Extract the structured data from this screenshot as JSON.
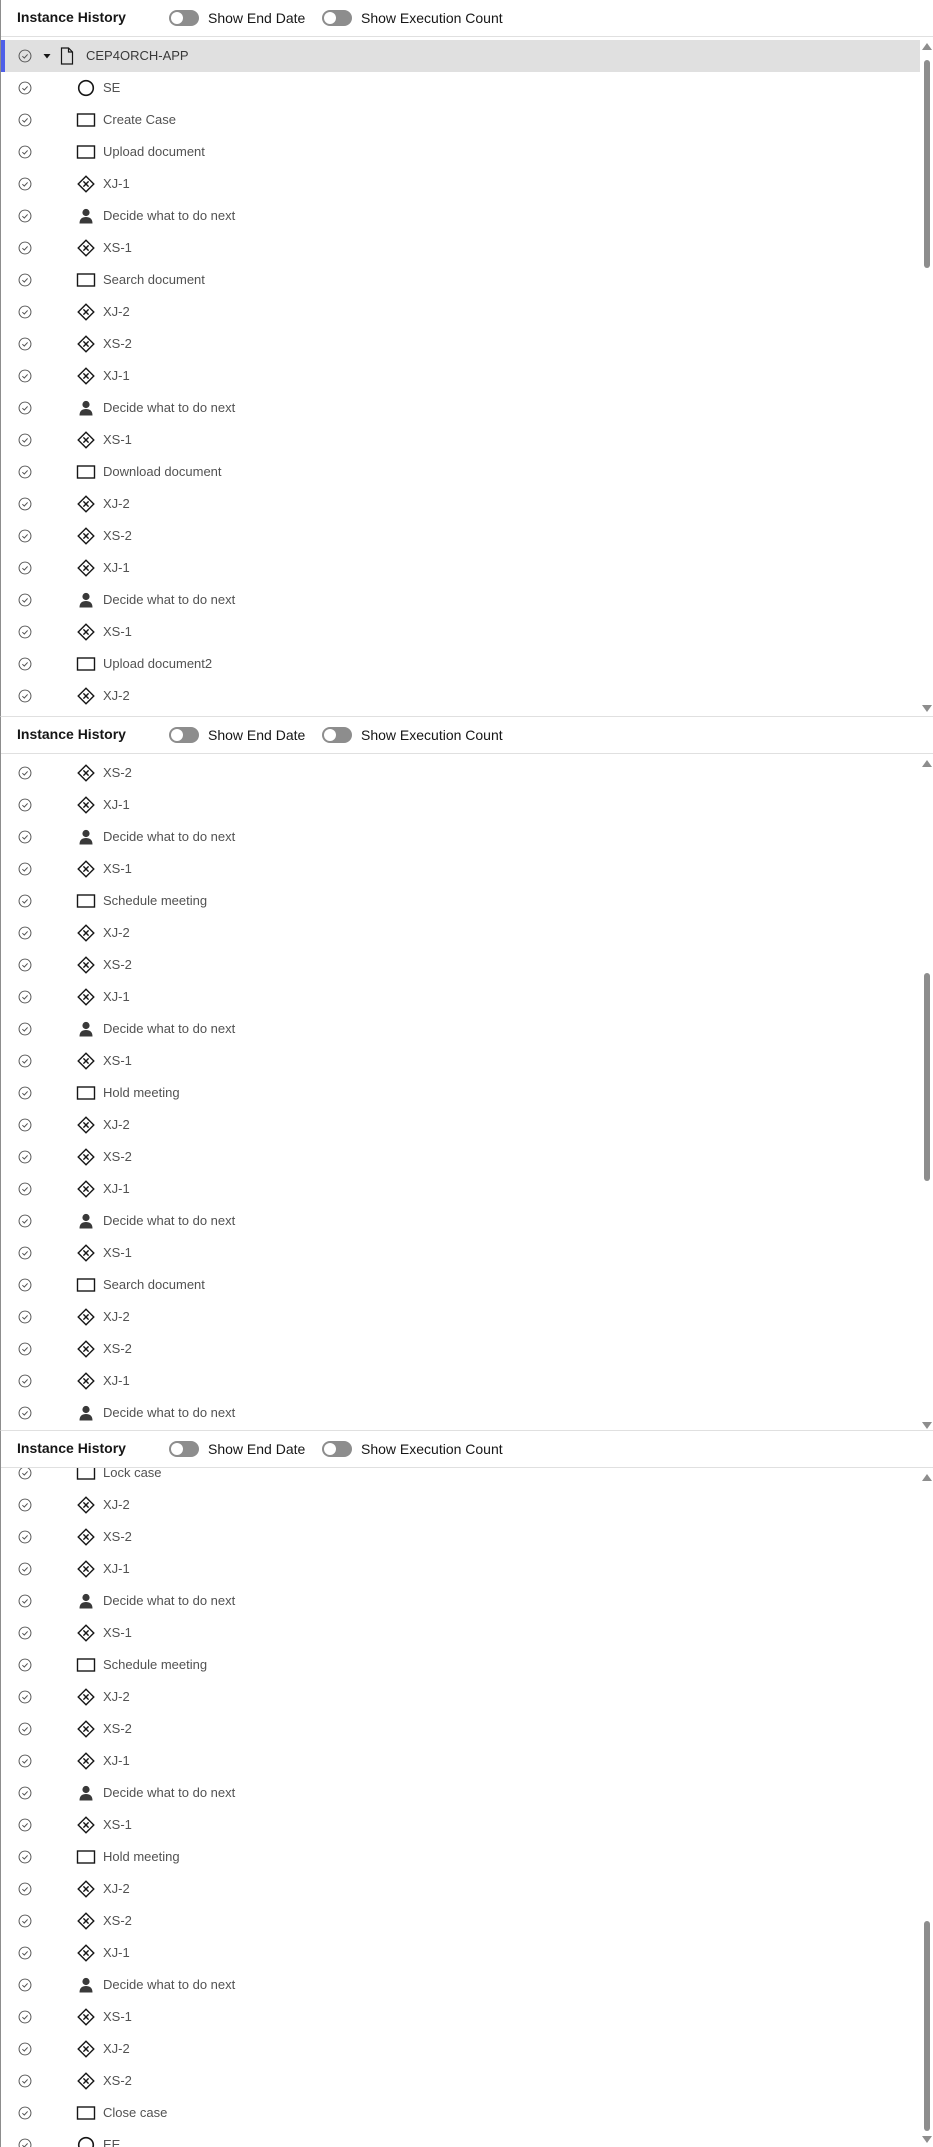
{
  "header": {
    "title": "Instance History",
    "toggle_end_date": "Show End Date",
    "toggle_exec_count": "Show Execution Count"
  },
  "root": {
    "label": "CEP4ORCH-APP"
  },
  "panel1": {
    "rows": [
      {
        "type": "event",
        "label": "SE"
      },
      {
        "type": "task",
        "label": "Create Case"
      },
      {
        "type": "task",
        "label": "Upload document"
      },
      {
        "type": "gateway",
        "label": "XJ-1"
      },
      {
        "type": "user",
        "label": "Decide what to do next"
      },
      {
        "type": "gateway",
        "label": "XS-1"
      },
      {
        "type": "task",
        "label": "Search document"
      },
      {
        "type": "gateway",
        "label": "XJ-2"
      },
      {
        "type": "gateway",
        "label": "XS-2"
      },
      {
        "type": "gateway",
        "label": "XJ-1"
      },
      {
        "type": "user",
        "label": "Decide what to do next"
      },
      {
        "type": "gateway",
        "label": "XS-1"
      },
      {
        "type": "task",
        "label": "Download document"
      },
      {
        "type": "gateway",
        "label": "XJ-2"
      },
      {
        "type": "gateway",
        "label": "XS-2"
      },
      {
        "type": "gateway",
        "label": "XJ-1"
      },
      {
        "type": "user",
        "label": "Decide what to do next"
      },
      {
        "type": "gateway",
        "label": "XS-1"
      },
      {
        "type": "task",
        "label": "Upload document2"
      },
      {
        "type": "gateway",
        "label": "XJ-2"
      }
    ]
  },
  "panel2": {
    "rows": [
      {
        "type": "gateway",
        "label": "XS-2"
      },
      {
        "type": "gateway",
        "label": "XJ-1"
      },
      {
        "type": "user",
        "label": "Decide what to do next"
      },
      {
        "type": "gateway",
        "label": "XS-1"
      },
      {
        "type": "task",
        "label": "Schedule meeting"
      },
      {
        "type": "gateway",
        "label": "XJ-2"
      },
      {
        "type": "gateway",
        "label": "XS-2"
      },
      {
        "type": "gateway",
        "label": "XJ-1"
      },
      {
        "type": "user",
        "label": "Decide what to do next"
      },
      {
        "type": "gateway",
        "label": "XS-1"
      },
      {
        "type": "task",
        "label": "Hold meeting"
      },
      {
        "type": "gateway",
        "label": "XJ-2"
      },
      {
        "type": "gateway",
        "label": "XS-2"
      },
      {
        "type": "gateway",
        "label": "XJ-1"
      },
      {
        "type": "user",
        "label": "Decide what to do next"
      },
      {
        "type": "gateway",
        "label": "XS-1"
      },
      {
        "type": "task",
        "label": "Search document"
      },
      {
        "type": "gateway",
        "label": "XJ-2"
      },
      {
        "type": "gateway",
        "label": "XS-2"
      },
      {
        "type": "gateway",
        "label": "XJ-1"
      },
      {
        "type": "user",
        "label": "Decide what to do next"
      }
    ]
  },
  "panel3": {
    "rows": [
      {
        "type": "task",
        "label": "Lock case"
      },
      {
        "type": "gateway",
        "label": "XJ-2"
      },
      {
        "type": "gateway",
        "label": "XS-2"
      },
      {
        "type": "gateway",
        "label": "XJ-1"
      },
      {
        "type": "user",
        "label": "Decide what to do next"
      },
      {
        "type": "gateway",
        "label": "XS-1"
      },
      {
        "type": "task",
        "label": "Schedule meeting"
      },
      {
        "type": "gateway",
        "label": "XJ-2"
      },
      {
        "type": "gateway",
        "label": "XS-2"
      },
      {
        "type": "gateway",
        "label": "XJ-1"
      },
      {
        "type": "user",
        "label": "Decide what to do next"
      },
      {
        "type": "gateway",
        "label": "XS-1"
      },
      {
        "type": "task",
        "label": "Hold meeting"
      },
      {
        "type": "gateway",
        "label": "XJ-2"
      },
      {
        "type": "gateway",
        "label": "XS-2"
      },
      {
        "type": "gateway",
        "label": "XJ-1"
      },
      {
        "type": "user",
        "label": "Decide what to do next"
      },
      {
        "type": "gateway",
        "label": "XS-1"
      },
      {
        "type": "gateway",
        "label": "XJ-2"
      },
      {
        "type": "gateway",
        "label": "XS-2"
      },
      {
        "type": "task",
        "label": "Close case"
      },
      {
        "type": "event",
        "label": "EE"
      }
    ]
  },
  "icons": {
    "check": "check-circle-icon",
    "event": "event-circle-icon",
    "task": "task-rectangle-icon",
    "gateway": "gateway-diamond-icon",
    "user": "user-icon",
    "root": "document-icon",
    "caret": "caret-down-icon"
  },
  "colors": {
    "accent": "#4f5fe8",
    "icon": "#525252",
    "toggle_off": "#8d8d8d",
    "selected_row": "#e0e0e0"
  }
}
